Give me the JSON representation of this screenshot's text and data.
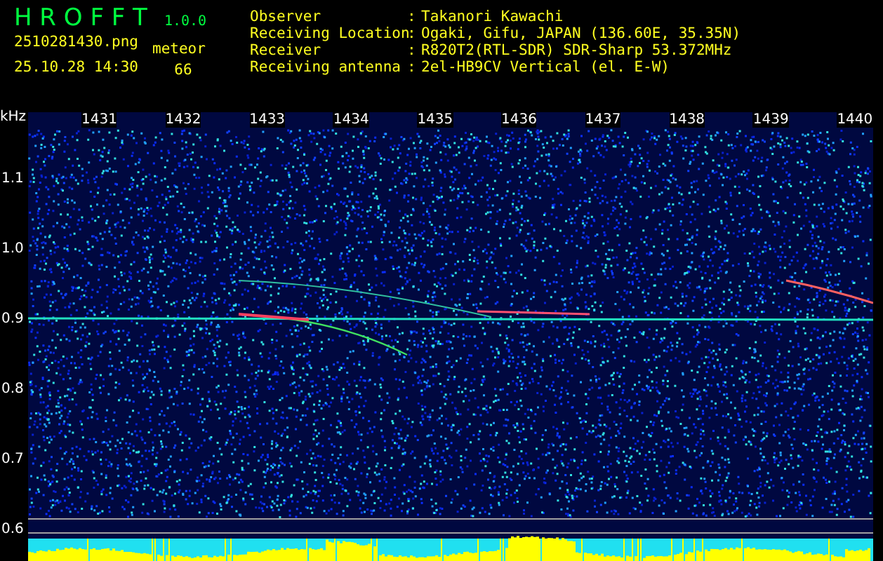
{
  "app": {
    "name": "H R O F F T",
    "version": "1.0.0"
  },
  "file": {
    "name": "2510281430.png",
    "timestamp": "25.10.28 14:30"
  },
  "detection": {
    "label": "meteor",
    "count": "66"
  },
  "info": [
    {
      "label": "Observer",
      "separator": ":",
      "value": "Takanori Kawachi"
    },
    {
      "label": "Receiving Location",
      "separator": ":",
      "value": "Ogaki, Gifu, JAPAN (136.60E, 35.35N)"
    },
    {
      "label": "Receiver",
      "separator": ":",
      "value": "R820T2(RTL-SDR) SDR-Sharp 53.372MHz"
    },
    {
      "label": "Receiving antenna",
      "separator": ":",
      "value": "2el-HB9CV Vertical (el. E-W)"
    }
  ],
  "spectrogram": {
    "unit": "kHz",
    "time_labels": [
      "1431",
      "1432",
      "1433",
      "1434",
      "1435",
      "1436",
      "1437",
      "1438",
      "1439",
      "1440"
    ],
    "freq_labels": [
      "1.1",
      "1.0",
      "0.9",
      "0.8",
      "0.7",
      "0.6"
    ]
  }
}
